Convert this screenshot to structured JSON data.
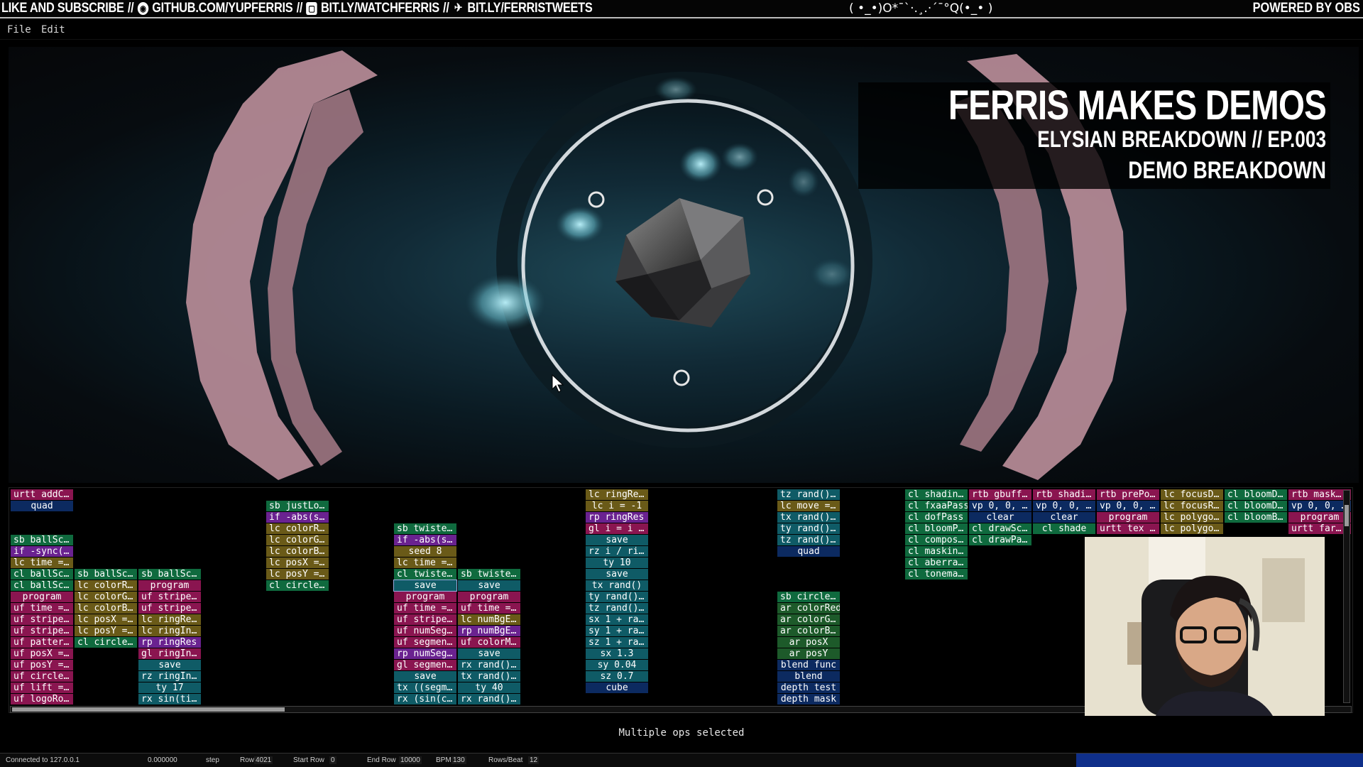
{
  "banner": {
    "left_parts": [
      "LIKE AND SUBSCRIBE",
      "//",
      "GITHUB.COM/YUPFERRIS",
      "//",
      "BIT.LY/WATCHFERRIS",
      "//",
      "BIT.LY/FERRISTWEETS"
    ],
    "center": "( •_•)O*¯`·.¸.·´¯°Q(•_• )",
    "right": "POWERED BY OBS"
  },
  "menu": {
    "file": "File",
    "edit": "Edit"
  },
  "overlay": {
    "title": "FERRIS MAKES DEMOS",
    "subtitle": "ELYSIAN BREAKDOWN // EP.003",
    "tag": "DEMO BREAKDOWN"
  },
  "op_columns": [
    {
      "ops": [
        {
          "row": 0,
          "label": "urtt addC…",
          "color": "pink"
        },
        {
          "row": 1,
          "label": "quad",
          "color": "navy",
          "center": true
        },
        {
          "row": 4,
          "label": "sb ballSc…",
          "color": "green"
        },
        {
          "row": 5,
          "label": "if -sync(…",
          "color": "purple"
        },
        {
          "row": 6,
          "label": "lc time =…",
          "color": "olive"
        },
        {
          "row": 7,
          "label": "cl ballSc…",
          "color": "green"
        },
        {
          "row": 8,
          "label": "cl ballSc…",
          "color": "green"
        },
        {
          "row": 9,
          "label": "program",
          "color": "pink",
          "center": true
        },
        {
          "row": 10,
          "label": "uf time =…",
          "color": "pink"
        },
        {
          "row": 11,
          "label": "uf stripe…",
          "color": "pink"
        },
        {
          "row": 12,
          "label": "uf stripe…",
          "color": "pink"
        },
        {
          "row": 13,
          "label": "uf patter…",
          "color": "pink"
        },
        {
          "row": 14,
          "label": "uf posX =…",
          "color": "pink"
        },
        {
          "row": 15,
          "label": "uf posY =…",
          "color": "pink"
        },
        {
          "row": 16,
          "label": "uf circle…",
          "color": "pink"
        },
        {
          "row": 17,
          "label": "uf lift =…",
          "color": "pink"
        },
        {
          "row": 18,
          "label": "uf logoRo…",
          "color": "pink"
        }
      ]
    },
    {
      "ops": [
        {
          "row": 7,
          "label": "sb ballSc…",
          "color": "green"
        },
        {
          "row": 8,
          "label": "lc colorR…",
          "color": "olive"
        },
        {
          "row": 9,
          "label": "lc colorG…",
          "color": "olive"
        },
        {
          "row": 10,
          "label": "lc colorB…",
          "color": "olive"
        },
        {
          "row": 11,
          "label": "lc posX =…",
          "color": "olive"
        },
        {
          "row": 12,
          "label": "lc posY =…",
          "color": "olive"
        },
        {
          "row": 13,
          "label": "cl circle…",
          "color": "green"
        }
      ]
    },
    {
      "ops": [
        {
          "row": 7,
          "label": "sb ballSc…",
          "color": "green"
        },
        {
          "row": 8,
          "label": "program",
          "color": "pink",
          "center": true
        },
        {
          "row": 9,
          "label": "uf stripe…",
          "color": "pink"
        },
        {
          "row": 10,
          "label": "uf stripe…",
          "color": "pink"
        },
        {
          "row": 11,
          "label": "lc ringRe…",
          "color": "olive"
        },
        {
          "row": 12,
          "label": "lc ringIn…",
          "color": "olive"
        },
        {
          "row": 13,
          "label": "rp ringRes",
          "color": "purple"
        },
        {
          "row": 14,
          "label": "gl ringIn…",
          "color": "pink"
        },
        {
          "row": 15,
          "label": "save",
          "color": "teal",
          "center": true
        },
        {
          "row": 16,
          "label": "rz ringIn…",
          "color": "teal"
        },
        {
          "row": 17,
          "label": "ty 17",
          "color": "teal",
          "center": true
        },
        {
          "row": 18,
          "label": "rx sin(ti…",
          "color": "teal"
        }
      ]
    },
    {
      "ops": [
        {
          "row": 1,
          "label": "sb justLo…",
          "color": "green"
        },
        {
          "row": 2,
          "label": "if -abs(s…",
          "color": "purple"
        },
        {
          "row": 3,
          "label": "lc colorR…",
          "color": "olive"
        },
        {
          "row": 4,
          "label": "lc colorG…",
          "color": "olive"
        },
        {
          "row": 5,
          "label": "lc colorB…",
          "color": "olive"
        },
        {
          "row": 6,
          "label": "lc posX =…",
          "color": "olive"
        },
        {
          "row": 7,
          "label": "lc posY =…",
          "color": "olive"
        },
        {
          "row": 8,
          "label": "cl circle…",
          "color": "green"
        }
      ]
    },
    {
      "ops": [
        {
          "row": 3,
          "label": "sb twiste…",
          "color": "green"
        },
        {
          "row": 4,
          "label": "if -abs(s…",
          "color": "purple"
        },
        {
          "row": 5,
          "label": "seed 8",
          "color": "olive",
          "center": true
        },
        {
          "row": 6,
          "label": "lc time =…",
          "color": "olive"
        },
        {
          "row": 7,
          "label": "cl twiste…",
          "color": "green"
        },
        {
          "row": 8,
          "label": "save",
          "color": "teal",
          "center": true,
          "sel": true
        },
        {
          "row": 9,
          "label": "program",
          "color": "pink",
          "center": true
        },
        {
          "row": 10,
          "label": "uf time =…",
          "color": "pink"
        },
        {
          "row": 11,
          "label": "uf stripe…",
          "color": "pink"
        },
        {
          "row": 12,
          "label": "uf numSeg…",
          "color": "pink"
        },
        {
          "row": 13,
          "label": "uf segmen…",
          "color": "pink"
        },
        {
          "row": 14,
          "label": "rp numSeg…",
          "color": "purple"
        },
        {
          "row": 15,
          "label": "gl segmen…",
          "color": "pink"
        },
        {
          "row": 16,
          "label": "save",
          "color": "teal",
          "center": true
        },
        {
          "row": 17,
          "label": "tx ((segm…",
          "color": "teal"
        },
        {
          "row": 18,
          "label": "rx (sin(c…",
          "color": "teal"
        }
      ]
    },
    {
      "ops": [
        {
          "row": 7,
          "label": "sb twiste…",
          "color": "green"
        },
        {
          "row": 8,
          "label": "save",
          "color": "teal",
          "center": true
        },
        {
          "row": 9,
          "label": "program",
          "color": "pink",
          "center": true
        },
        {
          "row": 10,
          "label": "uf time =…",
          "color": "pink"
        },
        {
          "row": 11,
          "label": "lc numBgE…",
          "color": "olive"
        },
        {
          "row": 12,
          "label": "rp numBgE…",
          "color": "purple"
        },
        {
          "row": 13,
          "label": "uf colorM…",
          "color": "pink"
        },
        {
          "row": 14,
          "label": "save",
          "color": "teal",
          "center": true
        },
        {
          "row": 15,
          "label": "rx rand()…",
          "color": "teal"
        },
        {
          "row": 16,
          "label": "tx rand()…",
          "color": "teal"
        },
        {
          "row": 17,
          "label": "ty 40",
          "color": "teal",
          "center": true
        },
        {
          "row": 18,
          "label": "rx rand()…",
          "color": "teal"
        }
      ]
    },
    {
      "ops": [
        {
          "row": 0,
          "label": "lc ringRe…",
          "color": "olive"
        },
        {
          "row": 1,
          "label": "lc i = -1",
          "color": "olive",
          "center": true
        },
        {
          "row": 2,
          "label": "rp ringRes",
          "color": "purple"
        },
        {
          "row": 3,
          "label": "gl i = i …",
          "color": "pink"
        },
        {
          "row": 4,
          "label": "save",
          "color": "teal",
          "center": true
        },
        {
          "row": 5,
          "label": "rz i / ri…",
          "color": "teal"
        },
        {
          "row": 6,
          "label": "ty 10",
          "color": "teal",
          "center": true
        },
        {
          "row": 7,
          "label": "save",
          "color": "teal",
          "center": true
        },
        {
          "row": 8,
          "label": "tx rand()",
          "color": "teal",
          "center": true
        },
        {
          "row": 9,
          "label": "ty rand()…",
          "color": "teal"
        },
        {
          "row": 10,
          "label": "tz rand()…",
          "color": "teal"
        },
        {
          "row": 11,
          "label": "sx 1 + ra…",
          "color": "teal"
        },
        {
          "row": 12,
          "label": "sy 1 + ra…",
          "color": "teal"
        },
        {
          "row": 13,
          "label": "sz 1 + ra…",
          "color": "teal"
        },
        {
          "row": 14,
          "label": "sx 1.3",
          "color": "teal",
          "center": true
        },
        {
          "row": 15,
          "label": "sy 0.04",
          "color": "teal",
          "center": true
        },
        {
          "row": 16,
          "label": "sz 0.7",
          "color": "teal",
          "center": true
        },
        {
          "row": 17,
          "label": "cube",
          "color": "navy",
          "center": true
        }
      ]
    },
    {
      "ops": [
        {
          "row": 0,
          "label": "tz rand()…",
          "color": "teal"
        },
        {
          "row": 1,
          "label": "lc move =…",
          "color": "olive"
        },
        {
          "row": 2,
          "label": "tx rand()…",
          "color": "teal"
        },
        {
          "row": 3,
          "label": "ty rand()…",
          "color": "teal"
        },
        {
          "row": 4,
          "label": "tz rand()…",
          "color": "teal"
        },
        {
          "row": 5,
          "label": "quad",
          "color": "navy",
          "center": true
        },
        {
          "row": 9,
          "label": "sb circle…",
          "color": "green"
        },
        {
          "row": 10,
          "label": "ar colorRed",
          "color": "dkgreen"
        },
        {
          "row": 11,
          "label": "ar colorG…",
          "color": "dkgreen"
        },
        {
          "row": 12,
          "label": "ar colorB…",
          "color": "dkgreen"
        },
        {
          "row": 13,
          "label": "ar posX",
          "color": "dkgreen",
          "center": true
        },
        {
          "row": 14,
          "label": "ar posY",
          "color": "dkgreen",
          "center": true
        },
        {
          "row": 15,
          "label": "blend func",
          "color": "navy",
          "center": true
        },
        {
          "row": 16,
          "label": "blend",
          "color": "navy",
          "center": true
        },
        {
          "row": 17,
          "label": "depth test",
          "color": "navy",
          "center": true
        },
        {
          "row": 18,
          "label": "depth mask",
          "color": "navy",
          "center": true
        }
      ]
    },
    {
      "ops": [
        {
          "row": 0,
          "label": "cl shadin…",
          "color": "green"
        },
        {
          "row": 1,
          "label": "cl fxaaPass",
          "color": "green"
        },
        {
          "row": 2,
          "label": "cl dofPass",
          "color": "green"
        },
        {
          "row": 3,
          "label": "cl bloomP…",
          "color": "green"
        },
        {
          "row": 4,
          "label": "cl compos…",
          "color": "green"
        },
        {
          "row": 5,
          "label": "cl maskin…",
          "color": "green"
        },
        {
          "row": 6,
          "label": "cl aberra…",
          "color": "green"
        },
        {
          "row": 7,
          "label": "cl tonema…",
          "color": "green"
        }
      ]
    },
    {
      "ops": [
        {
          "row": 0,
          "label": "rtb gbuff…",
          "color": "pink"
        },
        {
          "row": 1,
          "label": "vp 0, 0, …",
          "color": "navy"
        },
        {
          "row": 2,
          "label": "clear",
          "color": "navy",
          "center": true
        },
        {
          "row": 3,
          "label": "cl drawSc…",
          "color": "green"
        },
        {
          "row": 4,
          "label": "cl drawPa…",
          "color": "green"
        }
      ]
    },
    {
      "ops": [
        {
          "row": 0,
          "label": "rtb shadi…",
          "color": "pink"
        },
        {
          "row": 1,
          "label": "vp 0, 0, …",
          "color": "navy"
        },
        {
          "row": 2,
          "label": "clear",
          "color": "navy",
          "center": true
        },
        {
          "row": 3,
          "label": "cl shade",
          "color": "green",
          "center": true
        }
      ]
    },
    {
      "ops": [
        {
          "row": 0,
          "label": "rtb prePo…",
          "color": "pink"
        },
        {
          "row": 1,
          "label": "vp 0, 0, …",
          "color": "navy"
        },
        {
          "row": 2,
          "label": "program",
          "color": "pink",
          "center": true
        },
        {
          "row": 3,
          "label": "urtt tex …",
          "color": "pink"
        }
      ]
    },
    {
      "ops": [
        {
          "row": 0,
          "label": "lc focusD…",
          "color": "olive"
        },
        {
          "row": 1,
          "label": "lc focusR…",
          "color": "olive"
        },
        {
          "row": 2,
          "label": "lc polygo…",
          "color": "olive"
        },
        {
          "row": 3,
          "label": "lc polygo…",
          "color": "olive"
        }
      ]
    },
    {
      "ops": [
        {
          "row": 0,
          "label": "cl bloomD…",
          "color": "green"
        },
        {
          "row": 1,
          "label": "cl bloomD…",
          "color": "green"
        },
        {
          "row": 2,
          "label": "cl bloomB…",
          "color": "green"
        }
      ]
    },
    {
      "ops": [
        {
          "row": 0,
          "label": "rtb mask…",
          "color": "pink"
        },
        {
          "row": 1,
          "label": "vp 0, 0, …",
          "color": "navy"
        },
        {
          "row": 2,
          "label": "program",
          "color": "pink",
          "center": true
        },
        {
          "row": 3,
          "label": "urtt far…",
          "color": "pink"
        }
      ]
    }
  ],
  "status_message": "Multiple ops selected",
  "statusbar": {
    "connection": "Connected to 127.0.0.1",
    "time": "0.000000",
    "step": "step",
    "row_label": "Row",
    "row_value": "4021",
    "start_row_label": "Start Row",
    "start_row_value": "0",
    "end_row_label": "End Row",
    "end_row_value": "10000",
    "bpm_label": "BPM",
    "bpm_value": "130",
    "rows_beat_label": "Rows/Beat",
    "rows_beat_value": "12"
  }
}
